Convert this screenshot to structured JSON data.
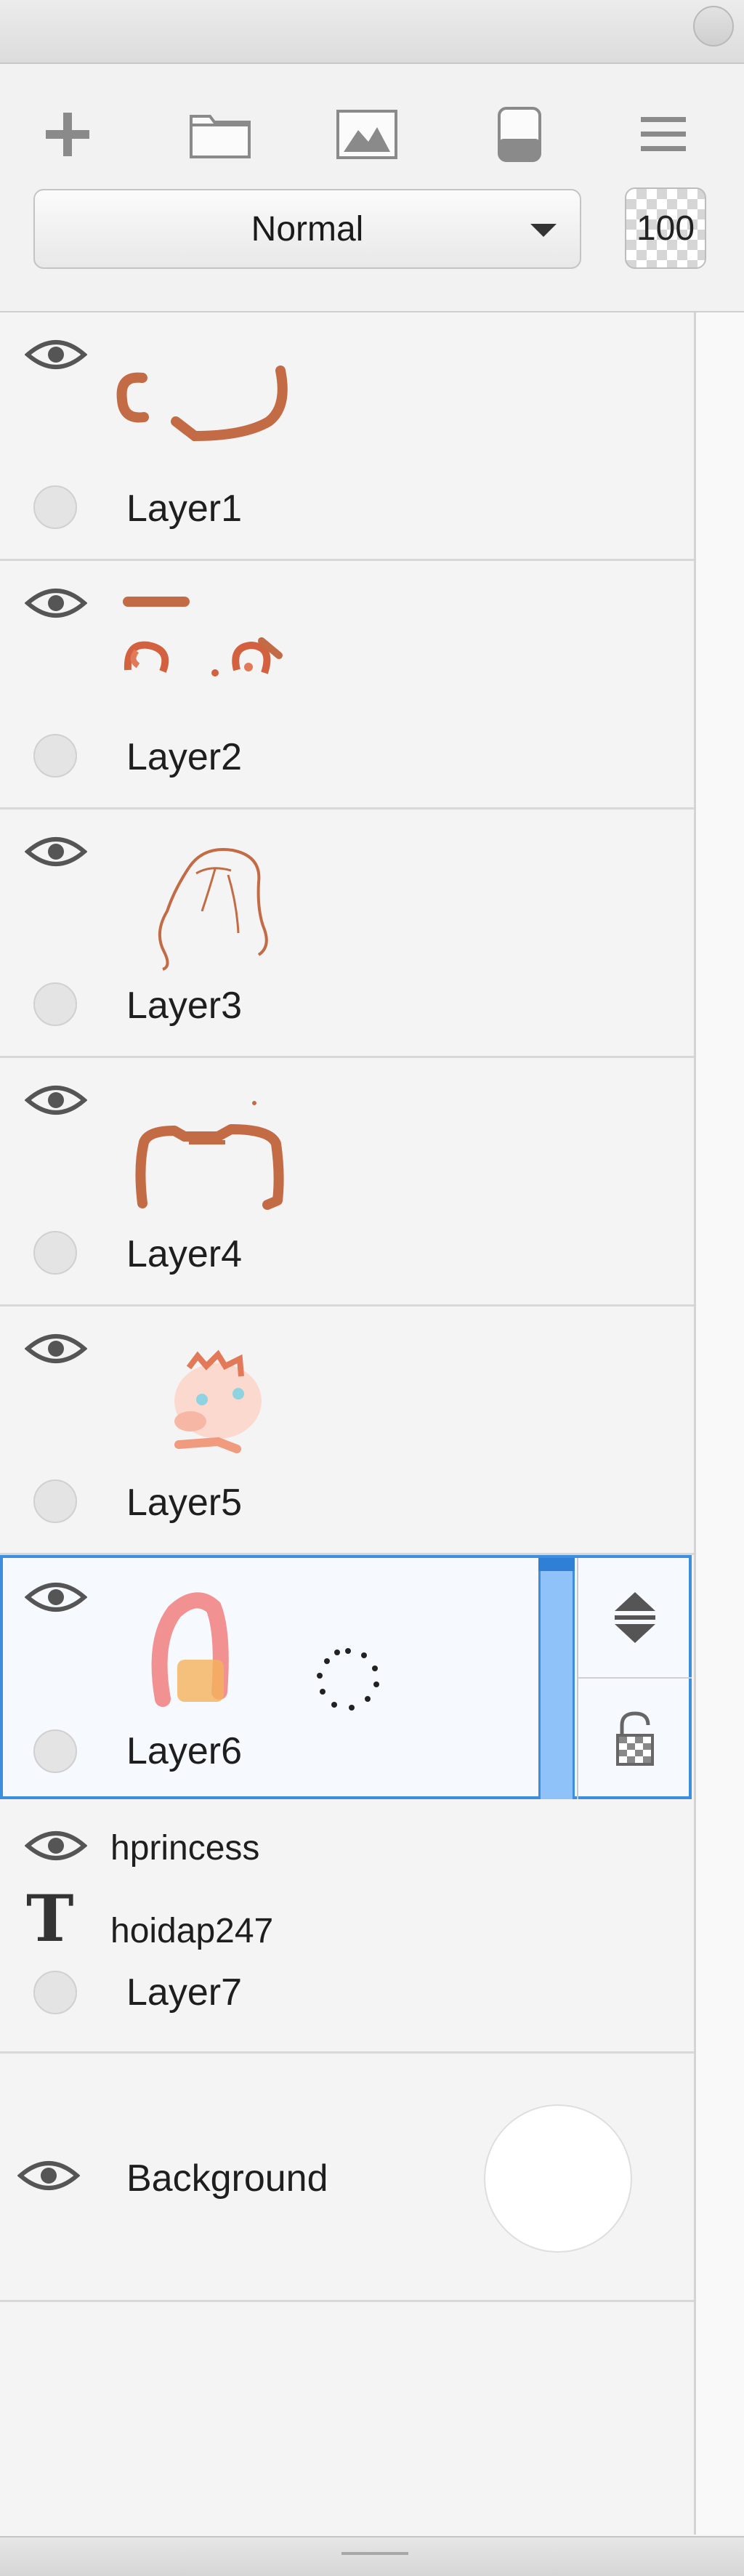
{
  "toolbar": {
    "blend_mode": "Normal",
    "opacity": "100",
    "icons": [
      "plus-icon",
      "folder-icon",
      "image-icon",
      "clipping-icon",
      "menu-icon"
    ]
  },
  "layers": [
    {
      "name": "Layer1"
    },
    {
      "name": "Layer2"
    },
    {
      "name": "Layer3"
    },
    {
      "name": "Layer4"
    },
    {
      "name": "Layer5"
    },
    {
      "name": "Layer6",
      "selected": true,
      "icons": [
        "loading-icon",
        "move-icon",
        "lock-open-icon"
      ]
    },
    {
      "name": "Layer7",
      "sublayers": [
        "hprincess",
        "hoidap247"
      ]
    },
    {
      "name": "Background"
    }
  ],
  "colors": {
    "accent": "#3e8ee0",
    "slider": "#8ec2f8",
    "thumb_stroke": "#c26b45"
  }
}
